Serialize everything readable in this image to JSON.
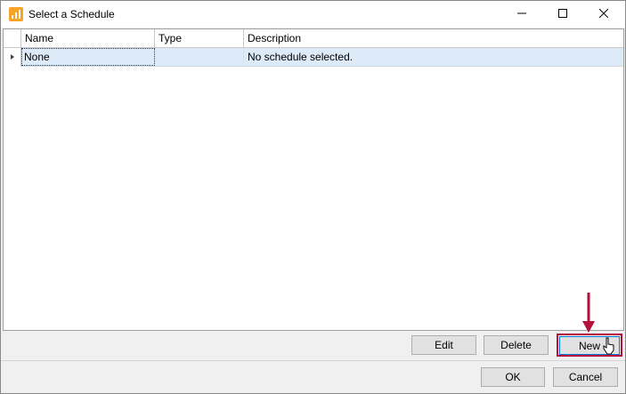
{
  "window": {
    "title": "Select a Schedule",
    "app_icon": "chart-bars-icon",
    "controls": [
      "minimize-icon",
      "maximize-icon",
      "close-icon"
    ]
  },
  "grid": {
    "columns": [
      "Name",
      "Type",
      "Description"
    ],
    "rows": [
      {
        "name": "None",
        "type": "",
        "description": "No schedule selected."
      }
    ],
    "selected_row_background": "#ddeaf7"
  },
  "actions": {
    "edit_label": "Edit",
    "delete_label": "Delete",
    "new_label": "New"
  },
  "footer": {
    "ok_label": "OK",
    "cancel_label": "Cancel"
  },
  "annotation": {
    "color": "#b5103c",
    "target": "New"
  }
}
